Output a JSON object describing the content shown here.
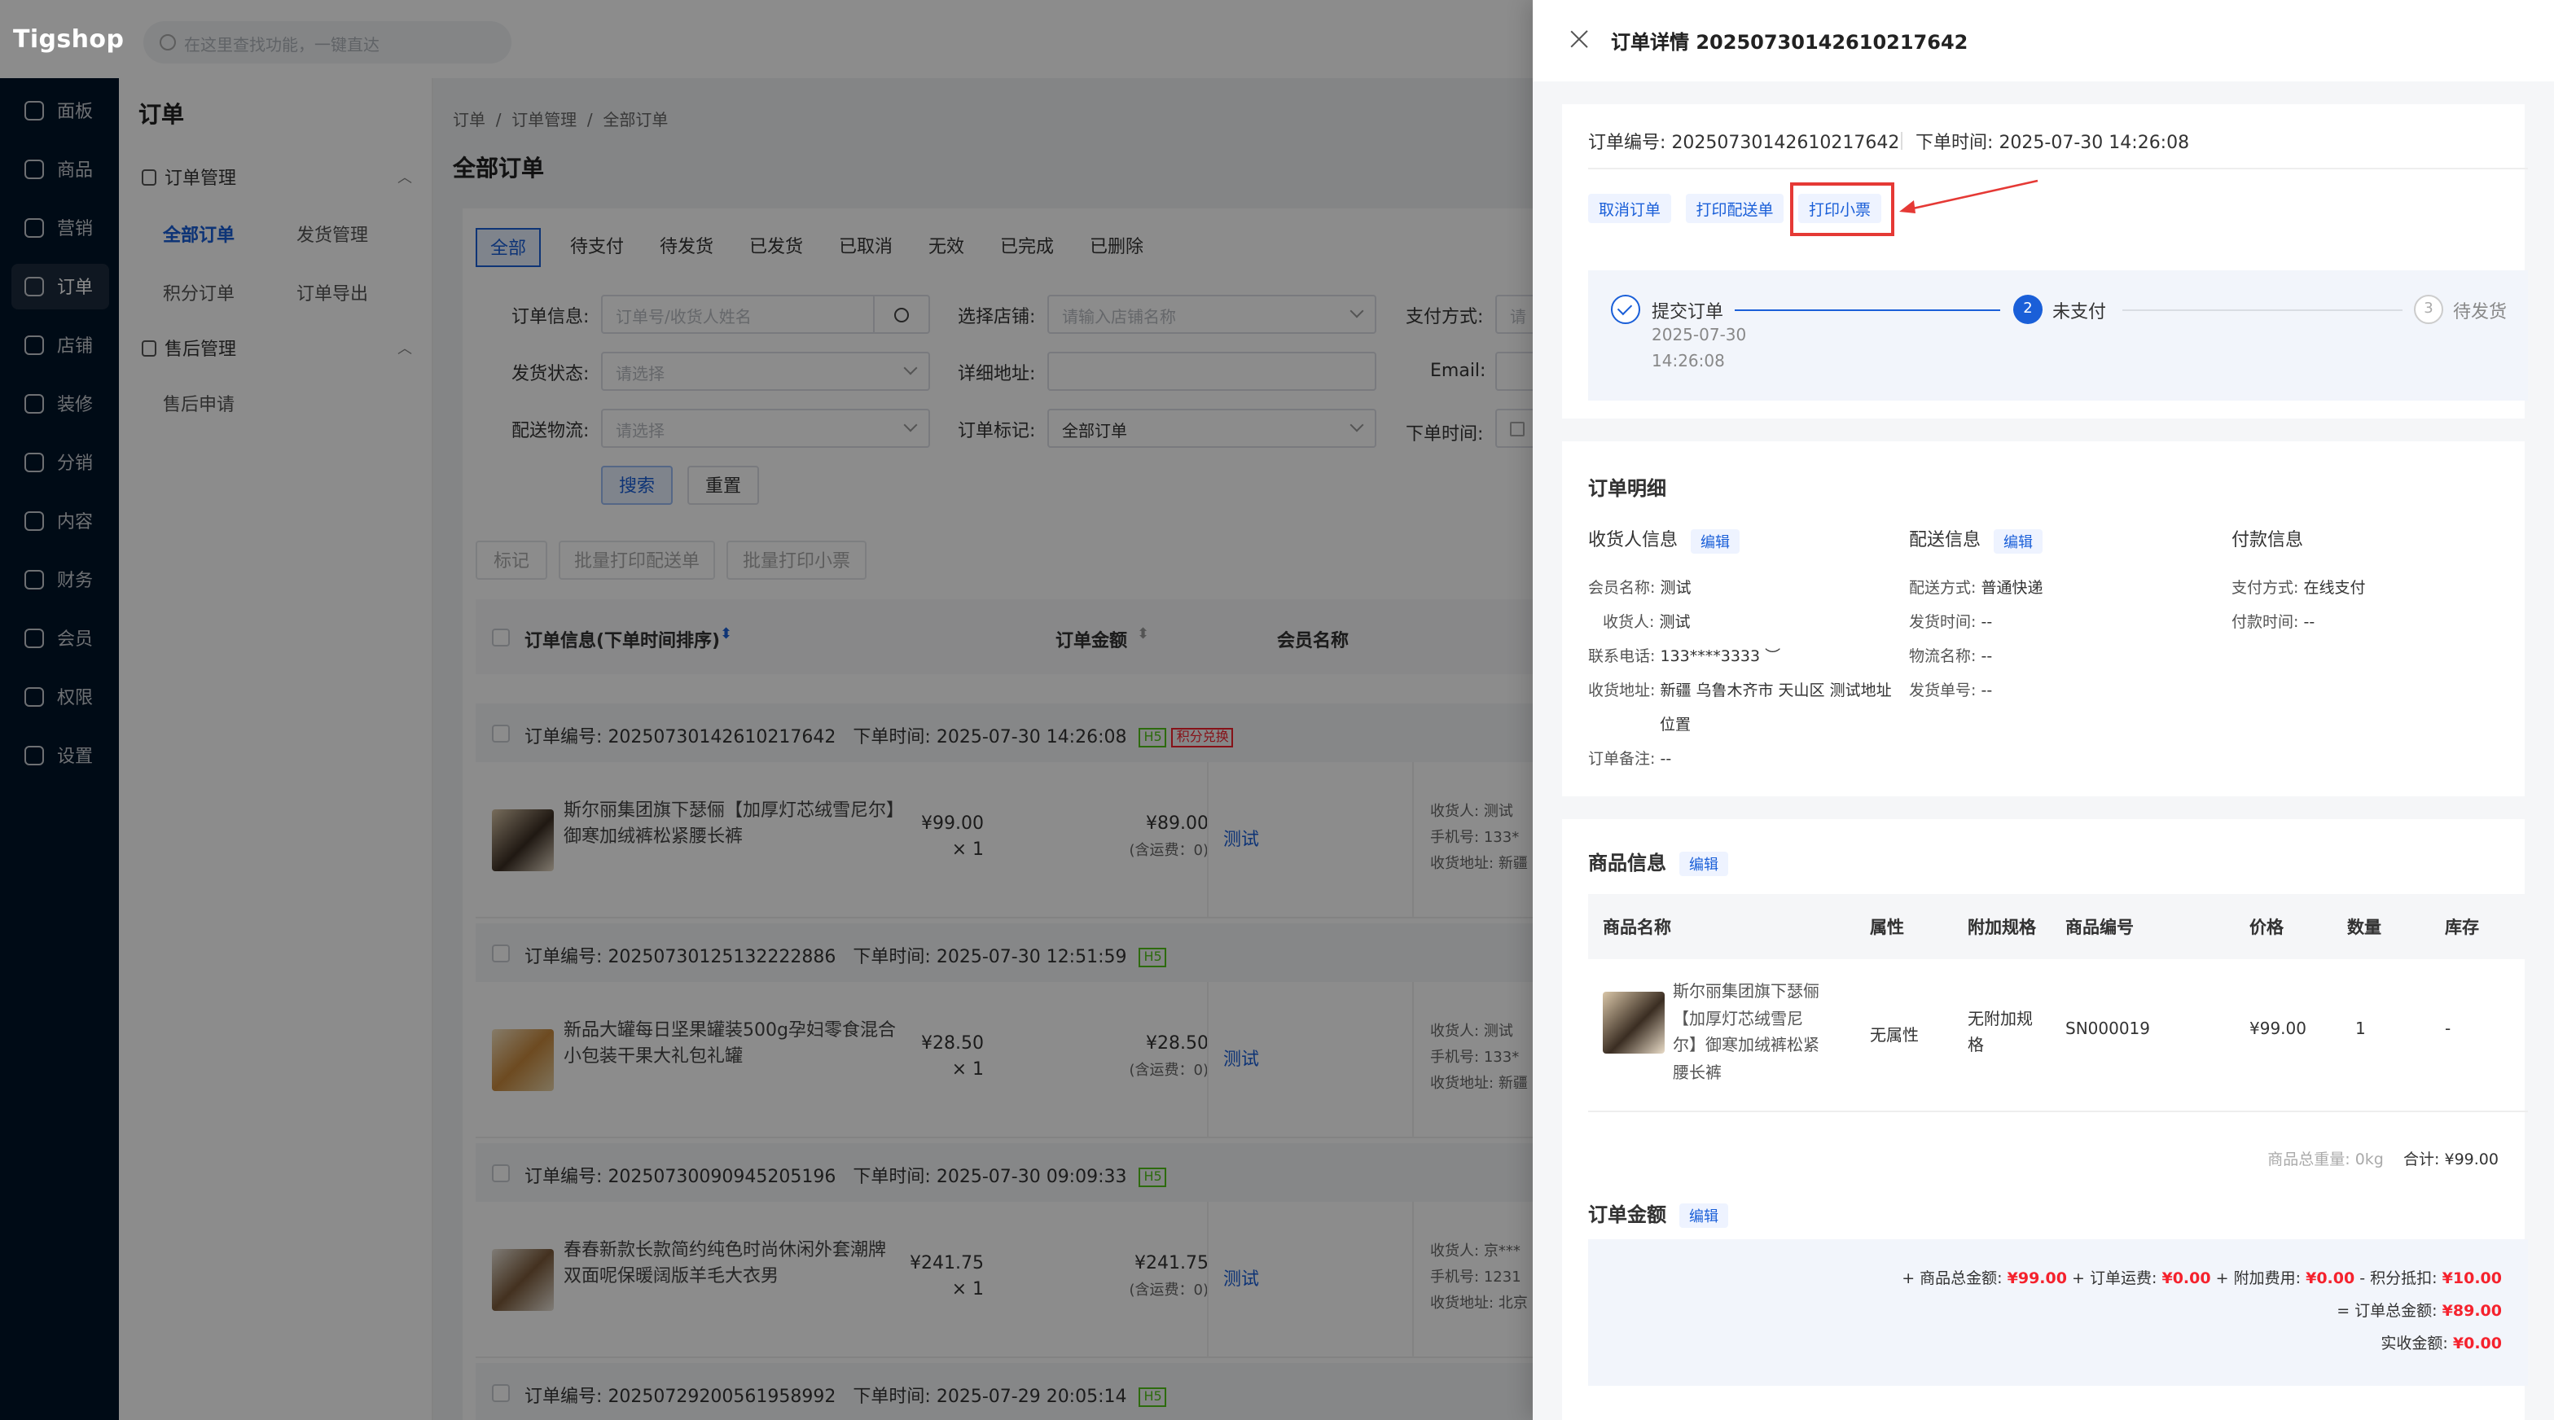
{
  "app": {
    "logo": "Tigshop",
    "search_placeholder": "在这里查找功能，一键直达"
  },
  "leftnav": [
    {
      "label": "面板",
      "icon": "dashboard-icon"
    },
    {
      "label": "商品",
      "icon": "box-icon"
    },
    {
      "label": "营销",
      "icon": "marketing-icon"
    },
    {
      "label": "订单",
      "icon": "order-icon",
      "active": true
    },
    {
      "label": "店铺",
      "icon": "store-icon"
    },
    {
      "label": "装修",
      "icon": "decorate-icon"
    },
    {
      "label": "分销",
      "icon": "distribution-icon"
    },
    {
      "label": "内容",
      "icon": "content-icon"
    },
    {
      "label": "财务",
      "icon": "finance-icon"
    },
    {
      "label": "会员",
      "icon": "member-icon"
    },
    {
      "label": "权限",
      "icon": "permission-icon"
    },
    {
      "label": "设置",
      "icon": "settings-icon"
    }
  ],
  "submenu": {
    "title": "订单",
    "group1": "订单管理",
    "group1_items": [
      "全部订单",
      "发货管理",
      "积分订单",
      "订单导出"
    ],
    "group2": "售后管理",
    "group2_items": [
      "售后申请"
    ]
  },
  "content": {
    "breadcrumb": [
      "订单",
      "订单管理",
      "全部订单"
    ],
    "page_title": "全部订单",
    "tabs": [
      "全部",
      "待支付",
      "待发货",
      "已发货",
      "已取消",
      "无效",
      "已完成",
      "已删除"
    ],
    "form": {
      "order_info_label": "订单信息:",
      "order_info_placeholder": "订单号/收货人姓名",
      "store_label": "选择店铺:",
      "store_placeholder": "请输入店铺名称",
      "pay_label": "支付方式:",
      "pay_placeholder": "请",
      "ship_status_label": "发货状态:",
      "ship_status_placeholder": "请选择",
      "address_label": "详细地址:",
      "email_label": "Email:",
      "logistics_label": "配送物流:",
      "logistics_placeholder": "请选择",
      "mark_label": "订单标记:",
      "mark_value": "全部订单",
      "time_label": "下单时间:",
      "search_btn": "搜索",
      "reset_btn": "重置"
    },
    "bulk": [
      "标记",
      "批量打印配送单",
      "批量打印小票"
    ],
    "table_head": {
      "order_info": "订单信息(下单时间排序)",
      "amount": "订单金额",
      "member": "会员名称"
    },
    "orders": [
      {
        "no_label": "订单编号:",
        "no": "20250730142610217642",
        "time_label": "下单时间:",
        "time": "2025-07-30 14:26:08",
        "tag": "H5",
        "tag2": "积分兑换",
        "product": "斯尔丽集团旗下瑟俪【加厚灯芯绒雪尼尔】御寒加绒裤松紧腰长裤",
        "unit_price": "¥99.00",
        "qty": "× 1",
        "amount": "¥89.00",
        "freight": "(含运费：0)",
        "member": "测试",
        "recv1": "收货人:",
        "recv1v": "测试",
        "recv2": "手机号:",
        "recv2v": "133*",
        "recv3": "收货地址:",
        "recv3v": "新疆"
      },
      {
        "no_label": "订单编号:",
        "no": "20250730125132222886",
        "time_label": "下单时间:",
        "time": "2025-07-30 12:51:59",
        "tag": "H5",
        "product": "新品大罐每日坚果罐装500g孕妇零食混合小包装干果大礼包礼罐",
        "unit_price": "¥28.50",
        "qty": "× 1",
        "amount": "¥28.50",
        "freight": "(含运费：0)",
        "member": "测试",
        "recv1": "收货人:",
        "recv1v": "测试",
        "recv2": "手机号:",
        "recv2v": "133*",
        "recv3": "收货地址:",
        "recv3v": "新疆"
      },
      {
        "no_label": "订单编号:",
        "no": "20250730090945205196",
        "time_label": "下单时间:",
        "time": "2025-07-30 09:09:33",
        "tag": "H5",
        "product": "春春新款长款简约纯色时尚休闲外套潮牌双面呢保暖阔版羊毛大衣男",
        "unit_price": "¥241.75",
        "qty": "× 1",
        "amount": "¥241.75",
        "freight": "(含运费：0)",
        "member": "测试",
        "recv1": "收货人:",
        "recv1v": "京***",
        "recv2": "手机号:",
        "recv2v": "1231",
        "recv3": "收货地址:",
        "recv3v": "北京"
      },
      {
        "no_label": "订单编号:",
        "no": "20250729200561958992",
        "time_label": "下单时间:",
        "time": "2025-07-29 20:05:14",
        "tag": "H5"
      }
    ]
  },
  "drawer": {
    "title": "订单详情 20250730142610217642",
    "order_no_label": "订单编号:",
    "order_no": "20250730142610217642",
    "order_time_label": "下单时间:",
    "order_time": "2025-07-30 14:26:08",
    "actions": [
      "取消订单",
      "打印配送单",
      "打印小票"
    ],
    "steps": [
      {
        "label": "提交订单",
        "date": "2025-07-30",
        "time": "14:26:08"
      },
      {
        "num": "2",
        "label": "未支付"
      },
      {
        "num": "3",
        "label": "待发货"
      }
    ],
    "detail_title": "订单明细",
    "consignee_title": "收货人信息",
    "delivery_title": "配送信息",
    "payment_title": "付款信息",
    "edit": "编辑",
    "consignee": {
      "member_label": "会员名称:",
      "member": "测试",
      "receiver_label": "收货人:",
      "receiver": "测试",
      "phone_label": "联系电话:",
      "phone": "133****3333",
      "addr_label": "收货地址:",
      "addr1": "新疆 乌鲁木齐市 天山区 测试地址",
      "addr2": "位置",
      "remark_label": "订单备注:",
      "remark": "--"
    },
    "delivery": {
      "method_label": "配送方式:",
      "method": "普通快递",
      "ship_time_label": "发货时间:",
      "ship_time": "--",
      "logistics_label": "物流名称:",
      "logistics": "--",
      "ship_no_label": "发货单号:",
      "ship_no": "--"
    },
    "payment": {
      "method_label": "支付方式:",
      "method": "在线支付",
      "time_label": "付款时间:",
      "time": "--"
    },
    "goods_title": "商品信息",
    "goods_head": [
      "商品名称",
      "属性",
      "附加规格",
      "商品编号",
      "价格",
      "数量",
      "库存"
    ],
    "goods_row": {
      "name": [
        "斯尔丽集团旗下瑟俪",
        "【加厚灯芯绒雪尼",
        "尔】御寒加绒裤松紧",
        "腰长裤"
      ],
      "attr": "无属性",
      "spec": [
        "无附加规",
        "格"
      ],
      "sn": "SN000019",
      "price": "¥99.00",
      "qty": "1",
      "stock": "-"
    },
    "weight_label": "商品总重量:",
    "weight": "0kg",
    "total_label": "合计:",
    "total": "¥99.00",
    "amount_title": "订单金额",
    "amount": {
      "goods_label": "+ 商品总金额:",
      "goods": "¥99.00",
      "freight_label": "+ 订单运费:",
      "freight": "¥0.00",
      "extra_label": "+ 附加费用:",
      "extra": "¥0.00",
      "points_label": "- 积分抵扣:",
      "points": "¥10.00",
      "order_total_label": "= 订单总金额:",
      "order_total": "¥89.00",
      "paid_label": "实收金额:",
      "paid": "¥0.00"
    }
  }
}
